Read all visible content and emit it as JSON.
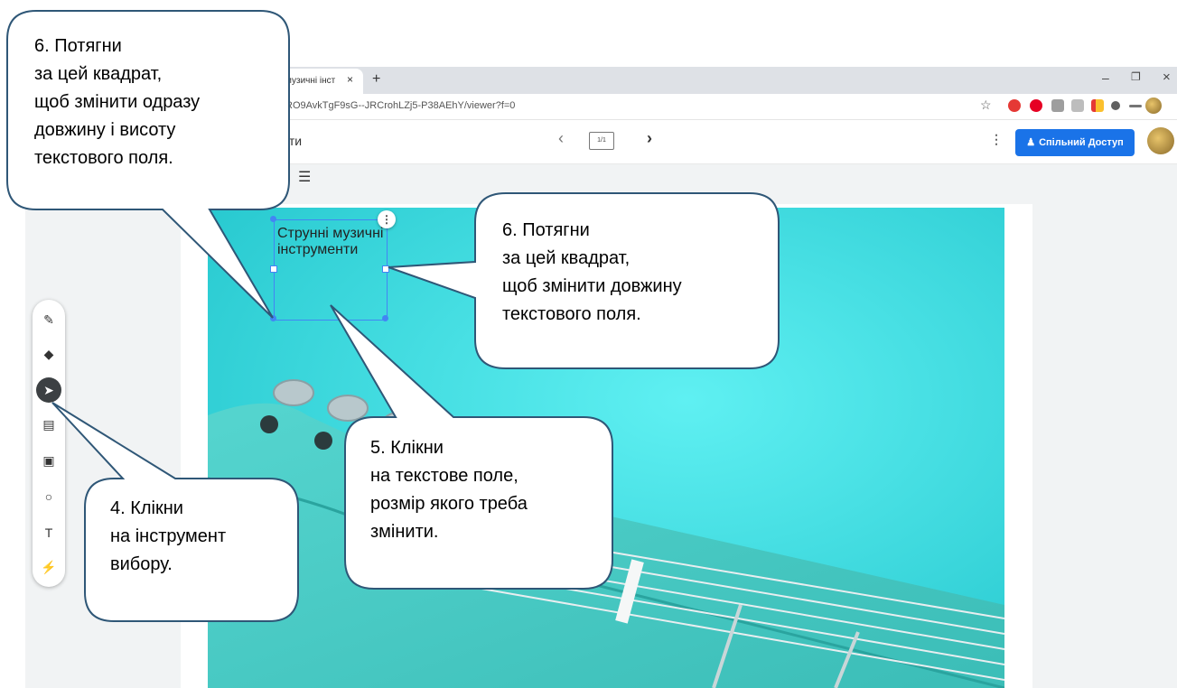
{
  "browser": {
    "tab_title": "музичні інст",
    "tab_close": "×",
    "new_tab": "+",
    "url": "RO9AvkTgF9sG--JRCrohLZj5-P38AEhY/viewer?f=0",
    "window_minimize": "–",
    "window_restore": "❐",
    "window_close": "×",
    "bookmark_icon": "☆"
  },
  "appbar": {
    "title_fragment": "ити",
    "prev": "‹",
    "page_indicator": "1/1",
    "next": "›",
    "more": "⋮",
    "share_label": "Спільний Доступ"
  },
  "format_toolbar": {
    "align_icon": "☰"
  },
  "textbox": {
    "text": "Струнні музичні інструменти",
    "menu": "⋮"
  },
  "tools": [
    {
      "name": "pen-icon",
      "glyph": "✎"
    },
    {
      "name": "eraser-icon",
      "glyph": "◆"
    },
    {
      "name": "select-icon",
      "glyph": "➤"
    },
    {
      "name": "sticky-note-icon",
      "glyph": "▤"
    },
    {
      "name": "image-icon",
      "glyph": "▣"
    },
    {
      "name": "shape-icon",
      "glyph": "○"
    },
    {
      "name": "text-box-icon",
      "glyph": "T"
    },
    {
      "name": "laser-icon",
      "glyph": "⚡"
    }
  ],
  "callouts": {
    "top_left": "6. Потягни\nза цей квадрат,\nщоб змінити одразу\nдовжину і висоту\nтекстового поля.",
    "top_right": "6. Потягни\nза цей квадрат,\nщоб змінити довжину\nтекстового поля.",
    "middle": "5. Клікни\nна текстове поле,\nрозмір якого треба\nзмінити.",
    "bottom_left": "4. Клікни\nна інструмент\nвибору."
  },
  "colors": {
    "accent": "#1a73e8",
    "photo_bg": "#3fdde3",
    "selection": "#4285f4",
    "callout_border": "#2f5777"
  }
}
